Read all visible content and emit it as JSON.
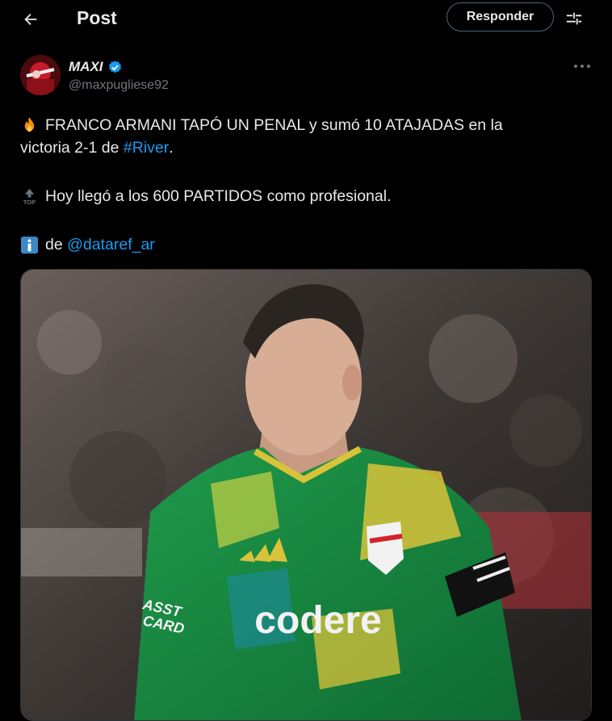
{
  "header": {
    "title": "Post",
    "reply_label": "Responder",
    "back_icon": "arrow-left-icon",
    "settings_icon": "sliders-icon"
  },
  "author": {
    "display_name": "MAXI",
    "handle": "@maxpugliese92",
    "verified": true
  },
  "tweet": {
    "line1": "FRANCO ARMANI TAPÓ UN PENAL y sumó 10 ATAJADAS en la",
    "line2_prefix": "victoria 2-1 de ",
    "line2_hashtag": "#River",
    "line2_suffix": ".",
    "line3": "Hoy llegó a los 600 PARTIDOS como profesional.",
    "line4_prefix": "de ",
    "line4_mention": "@dataref_ar"
  },
  "media": {
    "sponsor_text": "codere",
    "sleeve_text_1": "ASST",
    "sleeve_text_2": "CARD"
  },
  "colors": {
    "background": "#000000",
    "text": "#e7e9ea",
    "secondary": "#71767b",
    "link": "#1d9bf0",
    "verified": "#1d9bf0"
  }
}
